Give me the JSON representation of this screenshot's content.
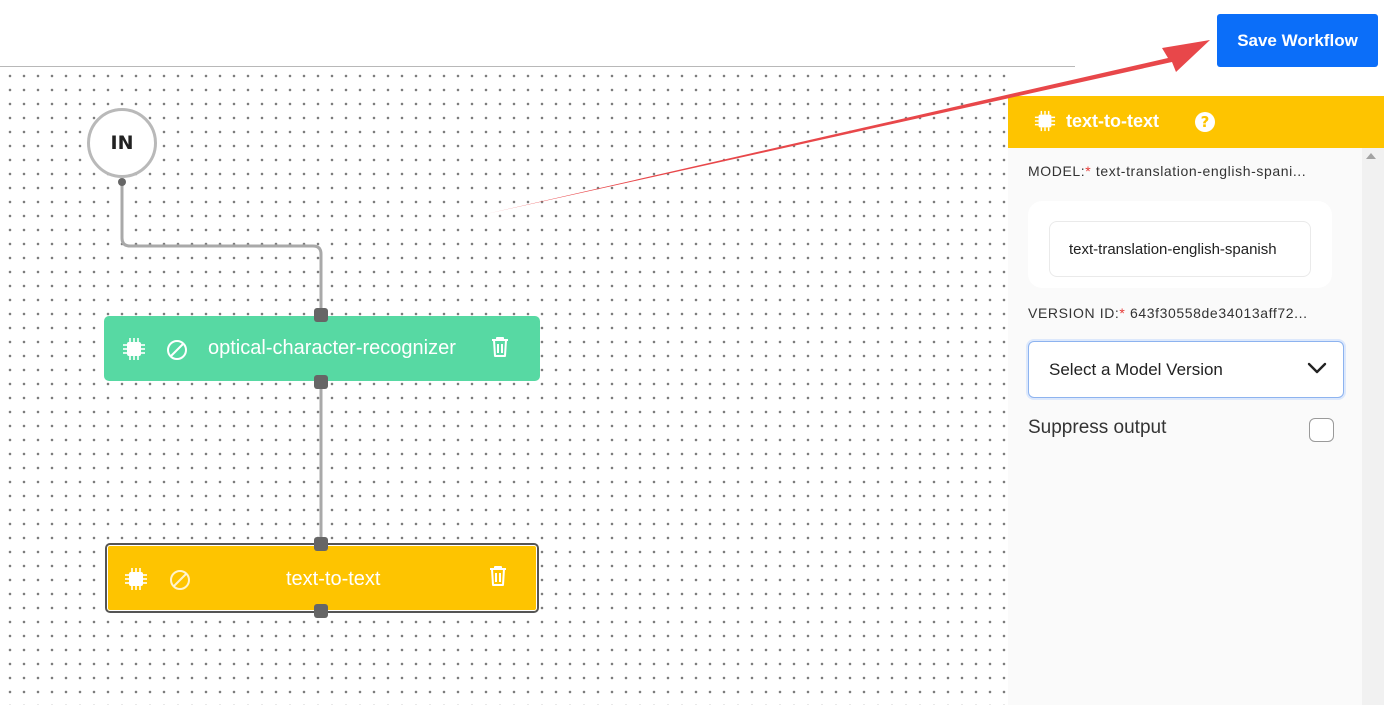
{
  "toolbar": {
    "save_label": "Save Workflow"
  },
  "canvas": {
    "input_node_label": "IN",
    "nodes": [
      {
        "label": "optical-character-recognizer",
        "color": "#57d9a3",
        "icon": "cpu-chip-icon",
        "state_icon": "ban-icon",
        "action_icon": "trash-icon"
      },
      {
        "label": "text-to-text",
        "color": "#fec400",
        "icon": "cpu-chip-icon",
        "state_icon": "ban-icon",
        "action_icon": "trash-icon",
        "selected": true
      }
    ]
  },
  "panel": {
    "title": "text-to-text",
    "header_color": "#fec400",
    "help_icon": "question-circle-icon",
    "model_label": "MODEL:",
    "model_value_truncated": "text-translation-english-spani...",
    "model_chip": "text-translation-english-spanish",
    "version_label": "VERSION ID:",
    "version_value_truncated": "643f30558de34013aff72...",
    "version_select": {
      "selected": "Select a Model Version"
    },
    "suppress_label": "Suppress output",
    "suppress_checked": false,
    "required_marker": "*"
  },
  "colors": {
    "accent": "#0b6ef9",
    "annotation_arrow": "#e8474a"
  }
}
